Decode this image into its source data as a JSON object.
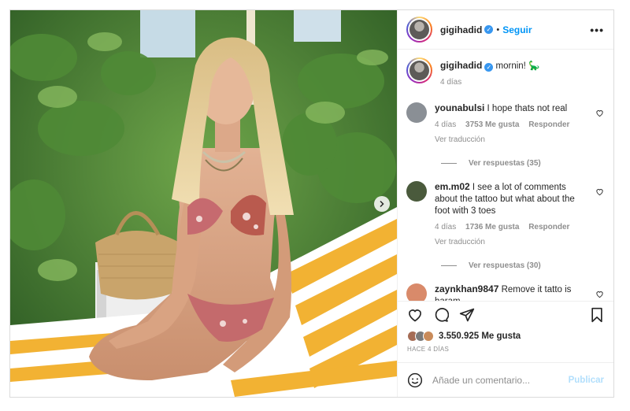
{
  "post": {
    "username": "gigihadid",
    "follow_label": "Seguir",
    "separator": "•",
    "more_label": "•••",
    "caption_user": "gigihadid",
    "caption_text": "mornin! 🦕",
    "caption_time": "4 días"
  },
  "comments": [
    {
      "user": "younabulsi",
      "text": "I hope thats not real",
      "time": "4 días",
      "likes": "3753 Me gusta",
      "reply": "Responder",
      "translate": "Ver traducción",
      "replies": "Ver respuestas (35)",
      "avatar_color": "#8a8f95"
    },
    {
      "user": "em.m02",
      "text": "I see a lot of comments about the tattoo but what about the foot with 3 toes",
      "time": "4 días",
      "likes": "1736 Me gusta",
      "reply": "Responder",
      "translate": "Ver traducción",
      "replies": "Ver respuestas (30)",
      "avatar_color": "#4a5a3c"
    },
    {
      "user": "zaynkhan9847",
      "text": "Remove it tatto is haram",
      "avatar_color": "#d98a6a"
    }
  ],
  "footer": {
    "likes": "3.550.925 Me gusta",
    "date": "HACE 4 DÍAS",
    "comment_placeholder": "Añade un comentario...",
    "publish": "Publicar"
  },
  "icons": {
    "like": "heart-icon",
    "comment": "comment-icon",
    "share": "paper-plane-icon",
    "save": "bookmark-icon",
    "emoji": "smiley-icon",
    "next": "chevron-right-icon"
  },
  "colors": {
    "link": "#0095f6",
    "verified": "#3897f0",
    "muted": "#8e8e8e",
    "publish_disabled": "#b2dffc"
  }
}
